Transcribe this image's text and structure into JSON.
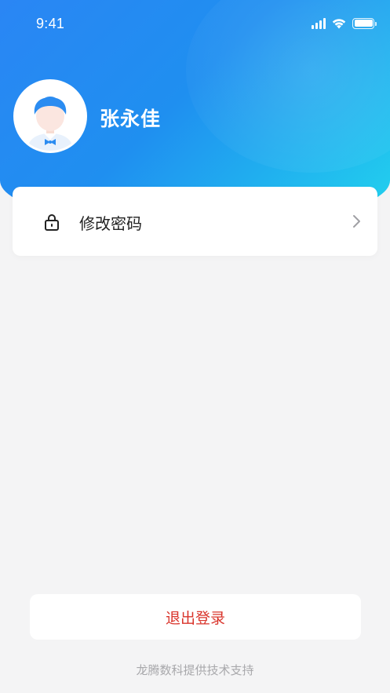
{
  "status_bar": {
    "time": "9:41",
    "signal_icon": "cellular-signal-icon",
    "wifi_icon": "wifi-icon",
    "battery_icon": "battery-icon"
  },
  "profile": {
    "name": "张永佳",
    "avatar_icon": "avatar-icon"
  },
  "menu": {
    "items": [
      {
        "label": "修改密码",
        "icon": "lock-icon",
        "trailing_icon": "chevron-right-icon"
      }
    ]
  },
  "logout": {
    "label": "退出登录"
  },
  "footer": {
    "text": "龙腾数科提供技术支持"
  },
  "colors": {
    "gradient_start": "#2a86f4",
    "gradient_end": "#22d4ee",
    "logout_text": "#d9342b",
    "background": "#f4f4f5"
  }
}
